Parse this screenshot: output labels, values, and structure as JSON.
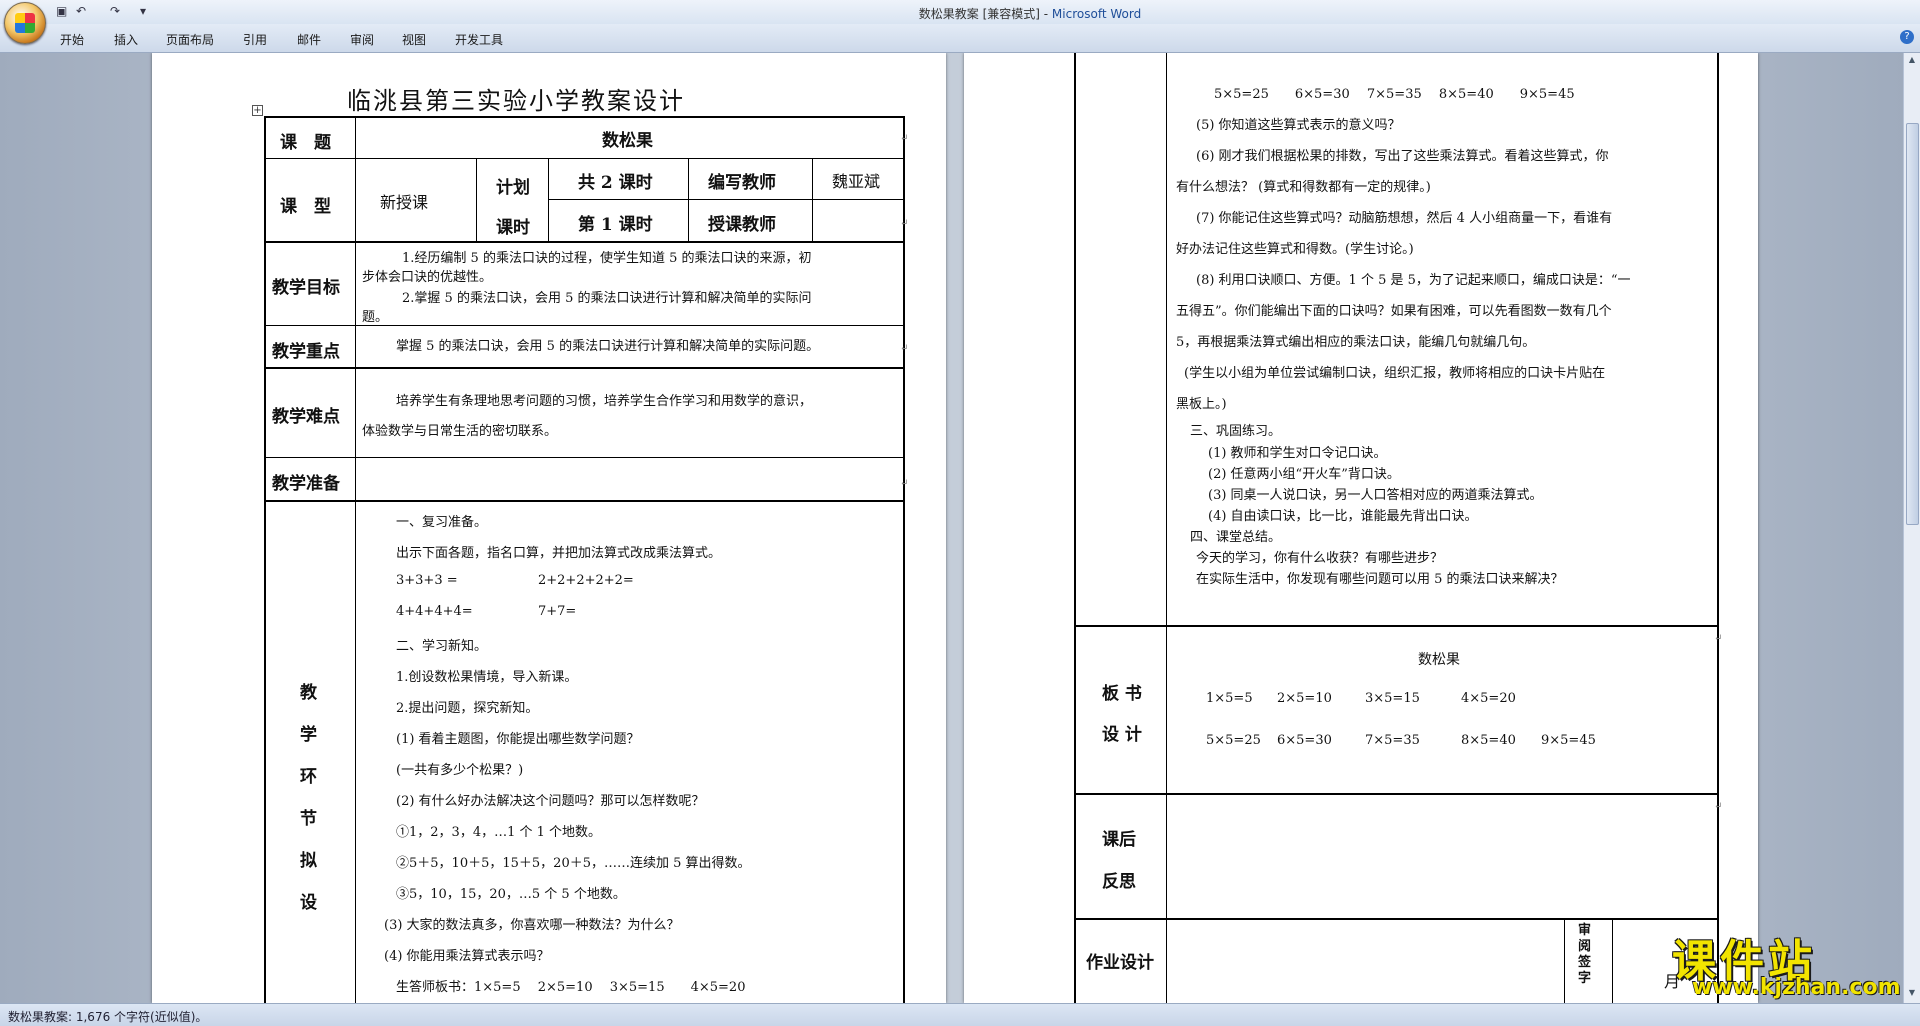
{
  "window": {
    "title_doc": "数松果教案 [兼容模式] - ",
    "title_app": "Microsoft Word",
    "qat": [
      "▣",
      "↶",
      "↷",
      "▾"
    ]
  },
  "menu": [
    "开始",
    "插入",
    "页面布局",
    "引用",
    "邮件",
    "审阅",
    "视图",
    "开发工具"
  ],
  "status": {
    "text": "数松果教案: 1,676 个字符(近似值)。"
  },
  "page1": {
    "title": "临洮县第三实验小学教案设计",
    "subject_label": "课　题",
    "subject_value": "数松果",
    "type_label": "课　型",
    "type_value": "新授课",
    "plan_label_1": "计划",
    "plan_label_2": "课时",
    "plan_total": "共 2 课时",
    "plan_current": "第 1 课时",
    "writer_label": "编写教师",
    "writer_value": "魏亚斌",
    "teacher_label": "授课教师",
    "goal_label": "教学目标",
    "goal_1a": "1.经历编制 5 的乘法口诀的过程，使学生知道 5 的乘法口诀的来源，初",
    "goal_1b": "步体会口诀的优越性。",
    "goal_2a": "2.掌握 5 的乘法口诀，会用 5 的乘法口诀进行计算和解决简单的实际问",
    "goal_2b": "题。",
    "key_label": "教学重点",
    "key_text": "掌握 5 的乘法口诀，会用 5 的乘法口诀进行计算和解决简单的实际问题。",
    "diff_label": "教学难点",
    "diff_a": "培养学生有条理地思考问题的习惯，培养学生合作学习和用数学的意识，",
    "diff_b": "体验数学与日常生活的密切联系。",
    "prep_label": "教学准备",
    "process_label": [
      "教",
      "学",
      "环",
      "节",
      "拟",
      "设"
    ],
    "lines": [
      "一、复习准备。",
      "出示下面各题，指名口算，并把加法算式改成乘法算式。",
      "3+3+3 =",
      "2+2+2+2+2=",
      "4+4+4+4=",
      "7+7=",
      "二、学习新知。",
      "1.创设数松果情境，导入新课。",
      "2.提出问题，探究新知。",
      "(1) 看着主题图，你能提出哪些数学问题？",
      "(一共有多少个松果？)",
      "(2) 有什么好办法解决这个问题吗？那可以怎样数呢？",
      "①1，2，3，4，…1 个 1 个地数。",
      "②5＋5，10＋5，15＋5，20＋5，……连续加 5 算出得数。",
      "③5，10，15，20，…5 个 5 个地数。",
      "(3) 大家的数法真多，你喜欢哪一种数法？为什么？",
      "(4) 你能用乘法算式表示吗？",
      "生答师板书：1×5=5　 2×5=10　 3×5=15　　4×5=20"
    ]
  },
  "page2": {
    "lines": [
      "5×5=25　　6×5=30　 7×5=35　 8×5=40　　9×5=45",
      "(5) 你知道这些算式表示的意义吗？",
      "(6) 刚才我们根据松果的排数，写出了这些乘法算式。看着这些算式，你",
      "有什么想法？ (算式和得数都有一定的规律。)",
      "(7) 你能记住这些算式吗？动脑筋想想，然后 4 人小组商量一下，看谁有",
      "好办法记住这些算式和得数。(学生讨论。)",
      "(8) 利用口诀顺口、方便。1 个 5 是 5，为了记起来顺口，编成口诀是：“一",
      "五得五”。你们能编出下面的口诀吗？如果有困难，可以先看图数一数有几个",
      "5，再根据乘法算式编出相应的乘法口诀，能编几句就编几句。",
      "(学生以小组为单位尝试编制口诀，组织汇报，教师将相应的口诀卡片贴在",
      "黑板上。)",
      "三、巩固练习。",
      "(1) 教师和学生对口令记口诀。",
      "(2) 任意两小组“开火车”背口诀。",
      "(3) 同桌一人说口诀，另一人口答相对应的两道乘法算式。",
      "(4) 自由读口诀，比一比，谁能最先背出口诀。",
      "四、课堂总结。",
      "今天的学习，你有什么收获？有哪些进步？",
      "在实际生活中，你发现有哪些问题可以用 5 的乘法口诀来解决？"
    ],
    "board_label_1": "板 书",
    "board_label_2": "设 计",
    "board_title": "数松果",
    "board_row1": [
      "1×5=5",
      "2×5=10",
      "3×5=15",
      "4×5=20"
    ],
    "board_row2": [
      "5×5=25",
      "6×5=30",
      "7×5=35",
      "8×5=40",
      "9×5=45"
    ],
    "reflect_label_1": "课后",
    "reflect_label_2": "反思",
    "homework_label": "作业设计",
    "review_label": [
      "审",
      "阅",
      "签",
      "字"
    ],
    "month_label": "月"
  },
  "paragraph_mark": "↵",
  "watermark": {
    "main": "课件站",
    "url": "www.kjzhan.com"
  }
}
